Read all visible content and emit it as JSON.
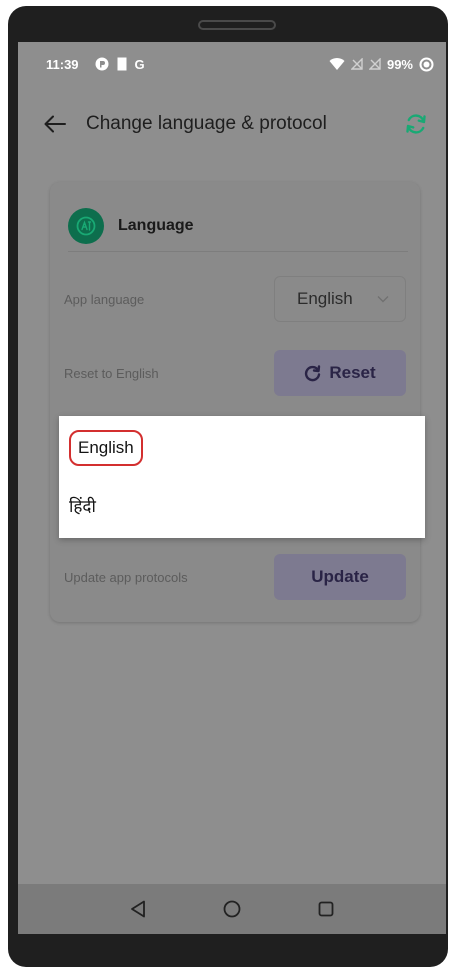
{
  "status_bar": {
    "time": "11:39",
    "carrier_letter": "G",
    "battery_percent": "99%"
  },
  "app_bar": {
    "title": "Change language & protocol"
  },
  "language_card": {
    "title": "Language",
    "app_language_label": "App language",
    "app_language_value": "English",
    "reset_label": "Reset to English",
    "reset_button": "Reset",
    "protocol_label": "Update app protocols",
    "update_button": "Update"
  },
  "dropdown": {
    "options": [
      "English",
      "हिंदी"
    ],
    "highlighted_index": 0
  },
  "colors": {
    "accent_green": "#19a974",
    "avatar_green": "#0d6e4d",
    "button_purple": "#7d7a90",
    "highlight_red": "#d32f2f"
  },
  "icons": {
    "back": "arrow-left-icon",
    "refresh": "refresh-icon",
    "language_avatar": "language-icon",
    "chevron": "chevron-down-icon",
    "reset": "reload-icon",
    "nav_back": "triangle-back-icon",
    "nav_home": "circle-home-icon",
    "nav_recents": "square-recents-icon"
  }
}
